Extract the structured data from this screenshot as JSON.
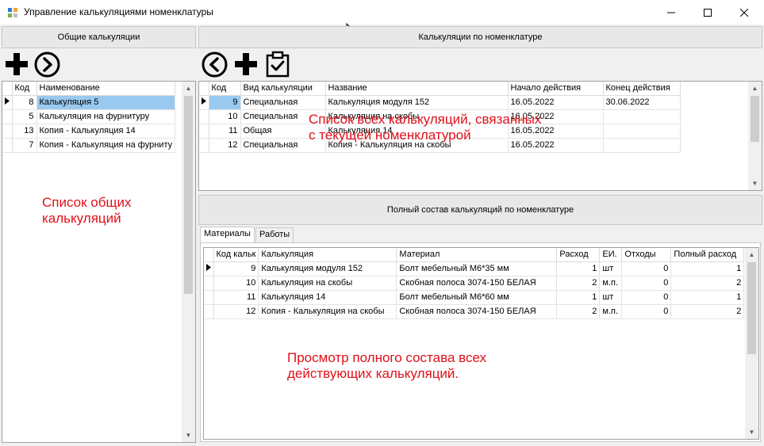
{
  "window": {
    "title": "Управление калькуляциями номенклатуры",
    "minimize_icon": "minimize-icon",
    "maximize_icon": "maximize-icon",
    "close_icon": "close-icon"
  },
  "left_panel": {
    "header": "Общие калькуляции",
    "toolbar": [
      "add-icon",
      "arrow-right-circle-icon"
    ],
    "columns": [
      "Код",
      "Наименование"
    ],
    "rows": [
      {
        "code": "8",
        "name": "Калькуляция 5",
        "current": true
      },
      {
        "code": "5",
        "name": "Калькуляция на фурнитуру",
        "current": false
      },
      {
        "code": "13",
        "name": "Копия - Калькуляция 14",
        "current": false
      },
      {
        "code": "7",
        "name": "Копия - Калькуляция на фурниту",
        "current": false
      }
    ]
  },
  "right_panel": {
    "header": "Калькуляции по номенклатуре",
    "toolbar": [
      "arrow-left-circle-icon",
      "add-icon",
      "clipboard-check-icon"
    ],
    "columns": [
      "Код",
      "Вид калькуляции",
      "Название",
      "Начало действия",
      "Конец действия"
    ],
    "rows": [
      {
        "code": "9",
        "type": "Специальная",
        "name": "Калькуляция модуля 152",
        "start": "16.05.2022",
        "end": "30.06.2022",
        "current": true
      },
      {
        "code": "10",
        "type": "Специальная",
        "name": "Калькуляция на скобы",
        "start": "16.05.2022",
        "end": "",
        "current": false
      },
      {
        "code": "11",
        "type": "Общая",
        "name": "Калькуляция 14",
        "start": "16.05.2022",
        "end": "",
        "current": false
      },
      {
        "code": "12",
        "type": "Специальная",
        "name": "Копия - Калькуляция на скобы",
        "start": "16.05.2022",
        "end": "",
        "current": false
      }
    ]
  },
  "composition": {
    "header": "Полный состав калькуляций по номенклатуре",
    "tabs": [
      "Материалы",
      "Работы"
    ],
    "active_tab": 0,
    "columns": [
      "Код кальк",
      "Калькуляция",
      "Материал",
      "Расход",
      "ЕИ.",
      "Отходы",
      "Полный расход"
    ],
    "rows": [
      {
        "code": "9",
        "calc": "Калькуляция модуля 152",
        "material": "Болт мебельный М6*35 мм",
        "usage": "1",
        "unit": "шт",
        "waste": "0",
        "total": "1",
        "current": true
      },
      {
        "code": "10",
        "calc": "Калькуляция на скобы",
        "material": "Скобная полоса 3074-150 БЕЛАЯ",
        "usage": "2",
        "unit": "м.п.",
        "waste": "0",
        "total": "2",
        "current": false
      },
      {
        "code": "11",
        "calc": "Калькуляция 14",
        "material": "Болт мебельный М6*60 мм",
        "usage": "1",
        "unit": "шт",
        "waste": "0",
        "total": "1",
        "current": false
      },
      {
        "code": "12",
        "calc": "Копия - Калькуляция на скобы",
        "material": "Скобная полоса 3074-150 БЕЛАЯ",
        "usage": "2",
        "unit": "м.п.",
        "waste": "0",
        "total": "2",
        "current": false
      }
    ]
  },
  "annotations": {
    "left": "Список общих\nкалькуляций",
    "top_right": "Список всех калькуляций, связанных\nс текущей номенклатурой",
    "bottom": "Просмотр полного состава всех\nдействующих калькуляций."
  },
  "colors": {
    "selection": "#99c9ef",
    "annotation": "#e0101a"
  }
}
